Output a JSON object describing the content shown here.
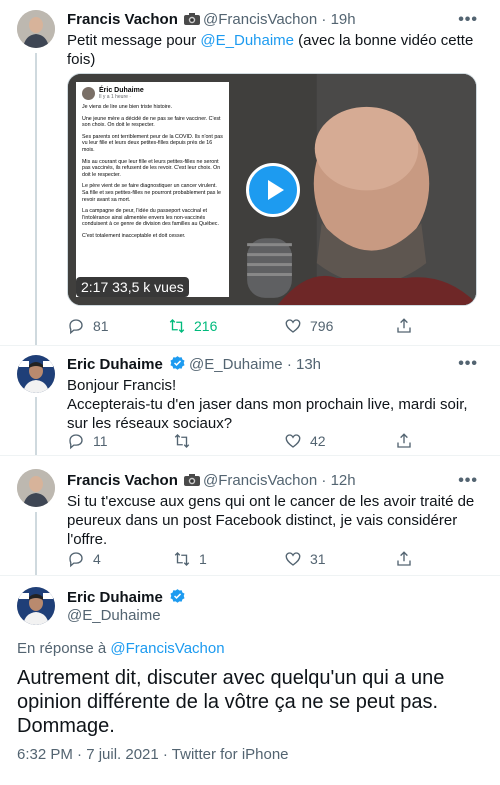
{
  "tweets": [
    {
      "author_name": "Francis Vachon",
      "author_handle": "@FrancisVachon",
      "time": "19h",
      "text_prefix": "Petit message pour ",
      "mention": "@E_Duhaime",
      "text_suffix": "  (avec la bonne vidéo cette fois)",
      "media": {
        "duration": "2:17",
        "views": "33,5 k vues",
        "fb_name": "Éric Duhaime",
        "fb_sub": "Il y a 1 heure ·",
        "fb_paragraphs": [
          "Je viens de lire une bien triste histoire.",
          "Une jeune mère a décidé de ne pas se faire vacciner. C'est son choix. On doit le respecter.",
          "Ses parents ont terriblement peur de la COVID. Ils n'ont pas vu leur fille et leurs deux petites-filles depuis près de 16 mois.",
          "Mis au courant que leur fille et leurs petites-filles ne seront pas vaccinés, ils refusent de les revoir. C'est leur choix. On doit le respecter.",
          "Le père vient de se faire diagnostiquer un cancer virulent. Sa fille et ses petites-filles ne pourront probablement pas le revoir avant sa mort.",
          "La campagne de peur, l'idée du passeport vaccinal et l'intolérance ainsi alimentée envers les non-vaccinés conduisent à ce genre de division des familles au Québec.",
          "C'est totalement inacceptable et doit cesser."
        ]
      },
      "replies": "81",
      "retweets": "216",
      "likes": "796"
    },
    {
      "author_name": "Eric Duhaime",
      "author_handle": "@E_Duhaime",
      "time": "13h",
      "line1": "Bonjour Francis!",
      "line2": "Accepterais-tu d'en jaser dans mon prochain live, mardi soir, sur les réseaux sociaux?",
      "replies": "11",
      "retweets": "",
      "likes": "42"
    },
    {
      "author_name": "Francis Vachon",
      "author_handle": "@FrancisVachon",
      "time": "12h",
      "text": "Si tu t'excuse aux gens qui ont le cancer de les avoir traité de peureux dans un post Facebook distinct, je vais considérer l'offre.",
      "replies": "4",
      "retweets": "1",
      "likes": "31"
    }
  ],
  "main_tweet": {
    "author_name": "Eric Duhaime",
    "author_handle": "@E_Duhaime",
    "reply_prefix": "En réponse à ",
    "reply_to": "@FrancisVachon",
    "text": "Autrement dit, discuter avec quelqu'un qui a une opinion différente de la vôtre ça ne se peut pas. Dommage.",
    "timestamp": "6:32 PM · 7 juil. 2021 · Twitter for iPhone"
  },
  "separator": " · ",
  "more_label": "•••",
  "colors": {
    "accent": "#1d9bf0",
    "retweet_active": "#00ba7c",
    "secondary_text": "#536471"
  },
  "icons": [
    "camera-emoji-icon",
    "verified-badge-icon",
    "reply-icon",
    "retweet-icon",
    "like-icon",
    "share-icon",
    "play-icon",
    "more-icon"
  ]
}
